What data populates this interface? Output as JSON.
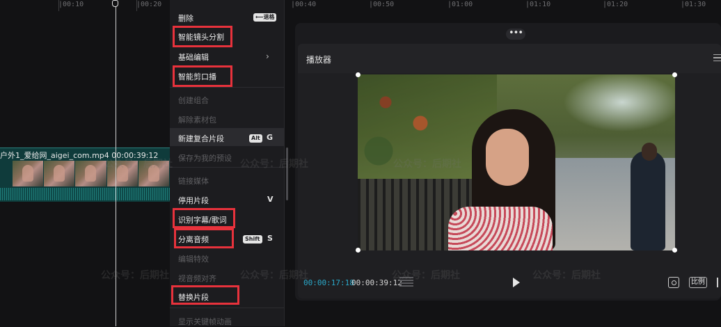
{
  "timeline": {
    "ruler_ticks": [
      "|00:10",
      "|00:20",
      "|00:40",
      "|00:50",
      "|01:00",
      "|01:10",
      "|01:20",
      "|01:30"
    ],
    "clip": {
      "title": "户外1_爱给网_aigei_com.mp4   00:00:39:12"
    }
  },
  "context_menu": {
    "items": [
      {
        "label": "删除",
        "enabled": true,
        "shortcut": "⟵退格"
      },
      {
        "label": "智能镜头分割",
        "enabled": true,
        "highlighted": true
      },
      {
        "label": "基础编辑",
        "enabled": true,
        "submenu": true
      },
      {
        "label": "智能剪口播",
        "enabled": true,
        "highlighted": true
      },
      {
        "label": "创建组合",
        "enabled": false
      },
      {
        "label": "解除素材包",
        "enabled": false
      },
      {
        "label": "新建复合片段",
        "enabled": true,
        "shortcut_mod": "Alt",
        "shortcut_key": "G"
      },
      {
        "label": "保存为我的预设",
        "enabled": false
      },
      {
        "label": "链接媒体",
        "enabled": false
      },
      {
        "label": "停用片段",
        "enabled": true,
        "shortcut_key": "V"
      },
      {
        "label": "识别字幕/歌词",
        "enabled": true,
        "highlighted": true
      },
      {
        "label": "分离音频",
        "enabled": true,
        "highlighted": true,
        "shortcut_mod": "Shift",
        "shortcut_key": "S"
      },
      {
        "label": "编辑特效",
        "enabled": false
      },
      {
        "label": "视音频对齐",
        "enabled": false
      },
      {
        "label": "替换片段",
        "enabled": true,
        "highlighted": true
      },
      {
        "label": "显示关键帧动画",
        "enabled": false
      }
    ],
    "submenu_arrow": "›"
  },
  "player": {
    "more_label": "•••",
    "title": "播放器",
    "current_time": "00:00:17:18",
    "duration": "00:00:39:12",
    "ratio_label": "比例"
  },
  "watermarks": [
    "公众号：后期社",
    "公众号：后期社",
    "公众号：后期社",
    "公众号：后期社",
    "公众号：后期社",
    "公众号：后期社",
    "公众号：后期社"
  ],
  "colors": {
    "highlight_box": "#e8323c",
    "accent_timecode": "#2aa8c9",
    "clip": "#0f3b3b"
  }
}
